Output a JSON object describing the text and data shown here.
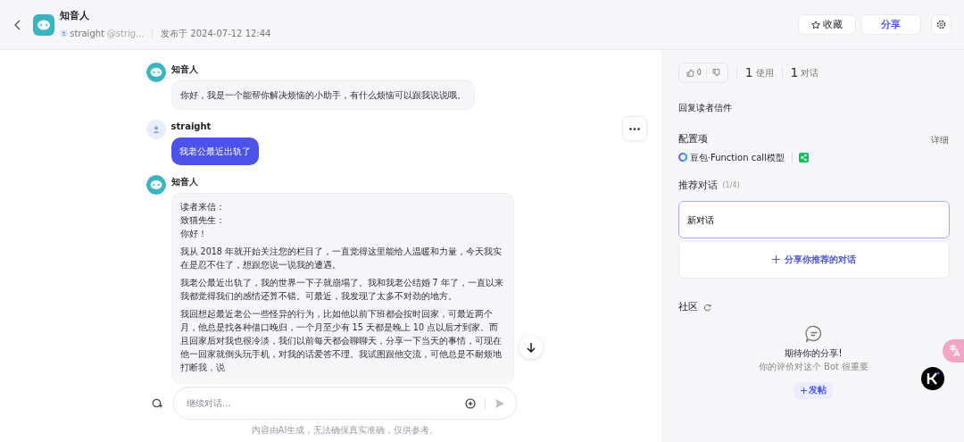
{
  "header": {
    "bot_name": "知音人",
    "author": "straight",
    "author_handle": "@strig...",
    "published": "发布于 2024-07-12 12:44",
    "buttons": [
      {
        "label": "收藏",
        "kind": "favorite"
      },
      {
        "label": "分享",
        "kind": "share"
      }
    ]
  },
  "messages": [
    {
      "kind": "bot",
      "sender": "知音人",
      "paragraphs": [
        "你好，我是一个能帮你解决烦恼的小助手，有什么烦恼可以跟我说说哦。"
      ]
    },
    {
      "kind": "user",
      "sender": "straight",
      "paragraphs": [
        "我老公最近出轨了"
      ]
    },
    {
      "kind": "bot",
      "sender": "知音人",
      "paragraphs": [
        [
          "读者来信：",
          "致猫先生：",
          "你好！"
        ],
        "我从 2018 年就开始关注您的栏目了，一直觉得这里能给人温暖和力量，今天我实在是忍不住了，想跟您说一说我的遭遇。",
        "我老公最近出轨了，我的世界一下子就崩塌了。我和我老公结婚 7 年了，一直以来我都觉得我们的感情还算不错。可最近，我发现了太多不对劲的地方。",
        "我回想起最近老公一些怪异的行为，比如他以前下班都会按时回家，可最近两个月，他总是找各种借口晚归，一个月至少有 15 天都是晚上 10 点以后才到家。而且回家后对我也很冷淡，我们以前每天都会聊聊天，分享一下当天的事情，可现在他一回家就倒头玩手机，对我的话爱答不理。我试图跟他交流，可他总是不耐烦地打断我，说"
      ]
    }
  ],
  "input": {
    "placeholder": "继续对话..."
  },
  "disclaimer": "内容由AI生成，无法确保真实准确，仅供参考。",
  "panel": {
    "likes": "0",
    "stats": [
      {
        "count": "1",
        "label": "使用"
      },
      {
        "count": "1",
        "label": "对话"
      }
    ],
    "description": "回复读者信件",
    "config": {
      "title": "配置项",
      "detail": "详细",
      "model": "豆包·Function call模型"
    },
    "recommend": {
      "title": "推荐对话",
      "count": "(1/4)",
      "items": [
        {
          "label": "新对话",
          "selected": true
        }
      ],
      "add": "分享你推荐的对话"
    },
    "community": {
      "title": "社区",
      "empty_title": "期待你的分享!",
      "empty_subtitle": "你的评价对这个 Bot 很重要",
      "post": "发帖"
    }
  }
}
